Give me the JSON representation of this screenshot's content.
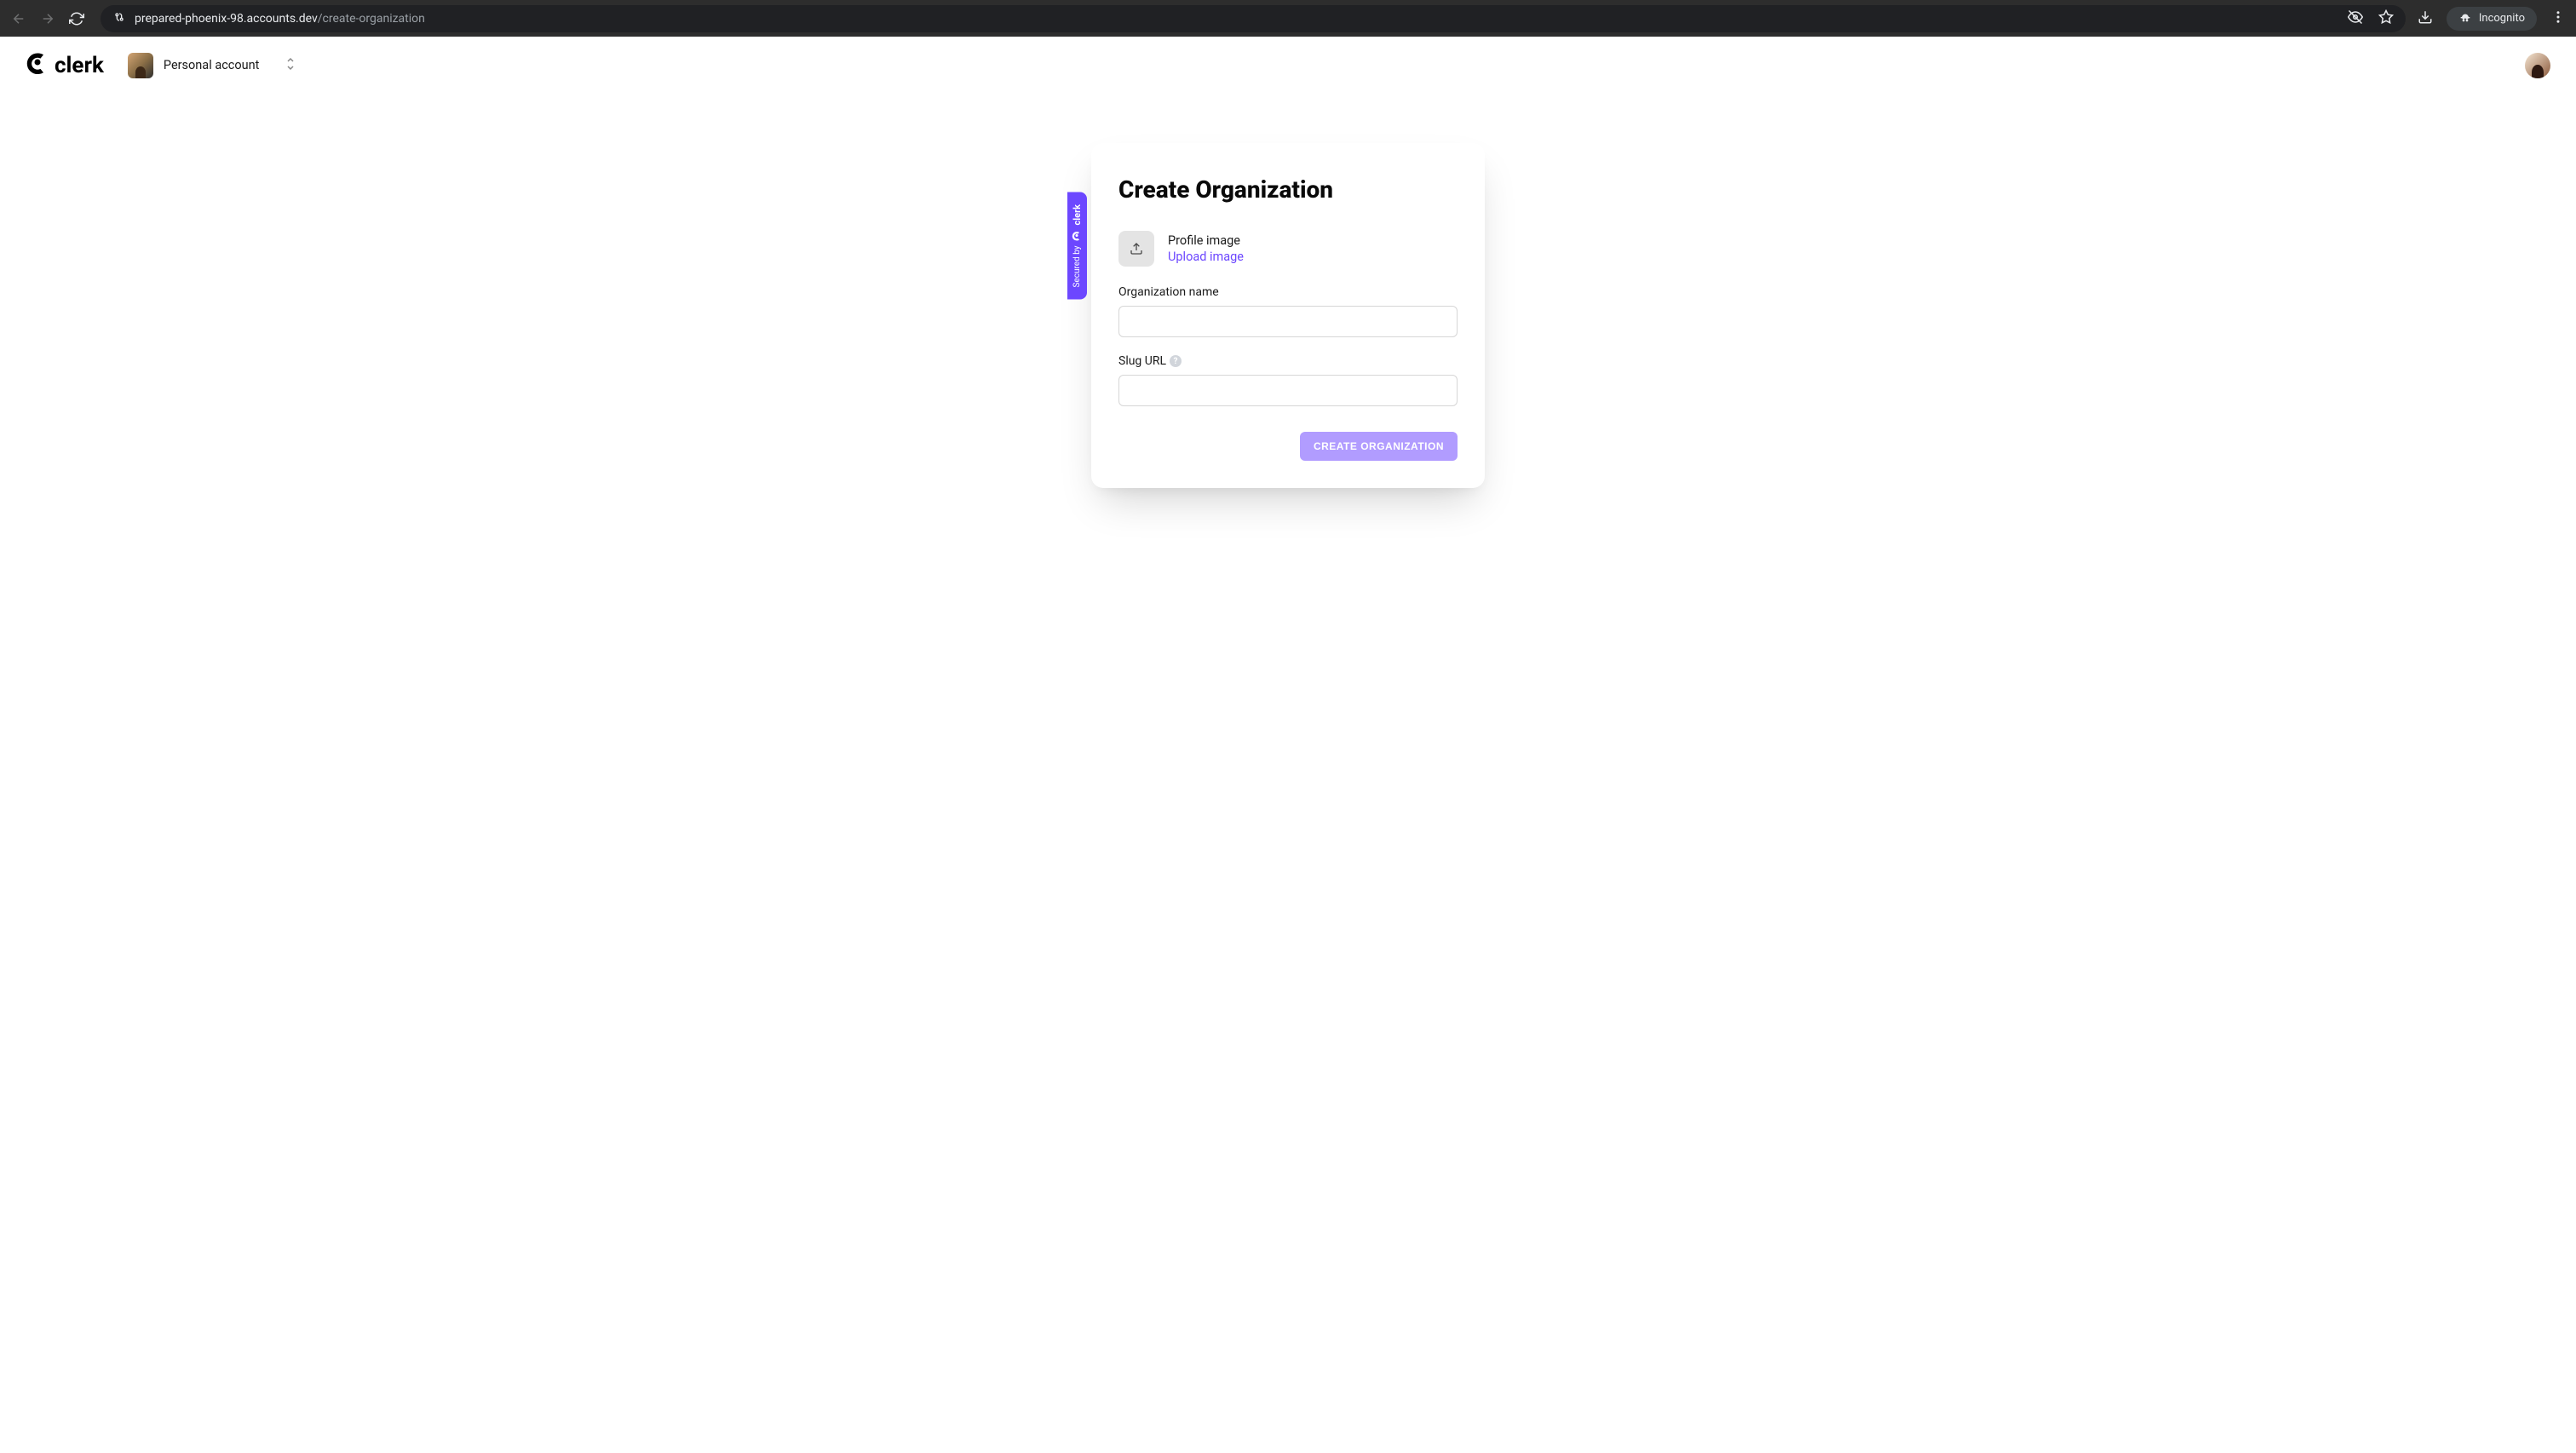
{
  "browser": {
    "url_host": "prepared-phoenix-98.accounts.dev",
    "url_path": "/create-organization",
    "incognito_label": "Incognito"
  },
  "header": {
    "logo_text": "clerk",
    "org_switcher_label": "Personal account"
  },
  "secured_tab": {
    "secured_by": "Secured by",
    "brand": "clerk"
  },
  "card": {
    "title": "Create Organization",
    "profile_image": {
      "label": "Profile image",
      "upload_link": "Upload image"
    },
    "fields": {
      "org_name": {
        "label": "Organization name",
        "value": ""
      },
      "slug": {
        "label": "Slug URL",
        "value": ""
      }
    },
    "submit_label": "Create Organization"
  }
}
